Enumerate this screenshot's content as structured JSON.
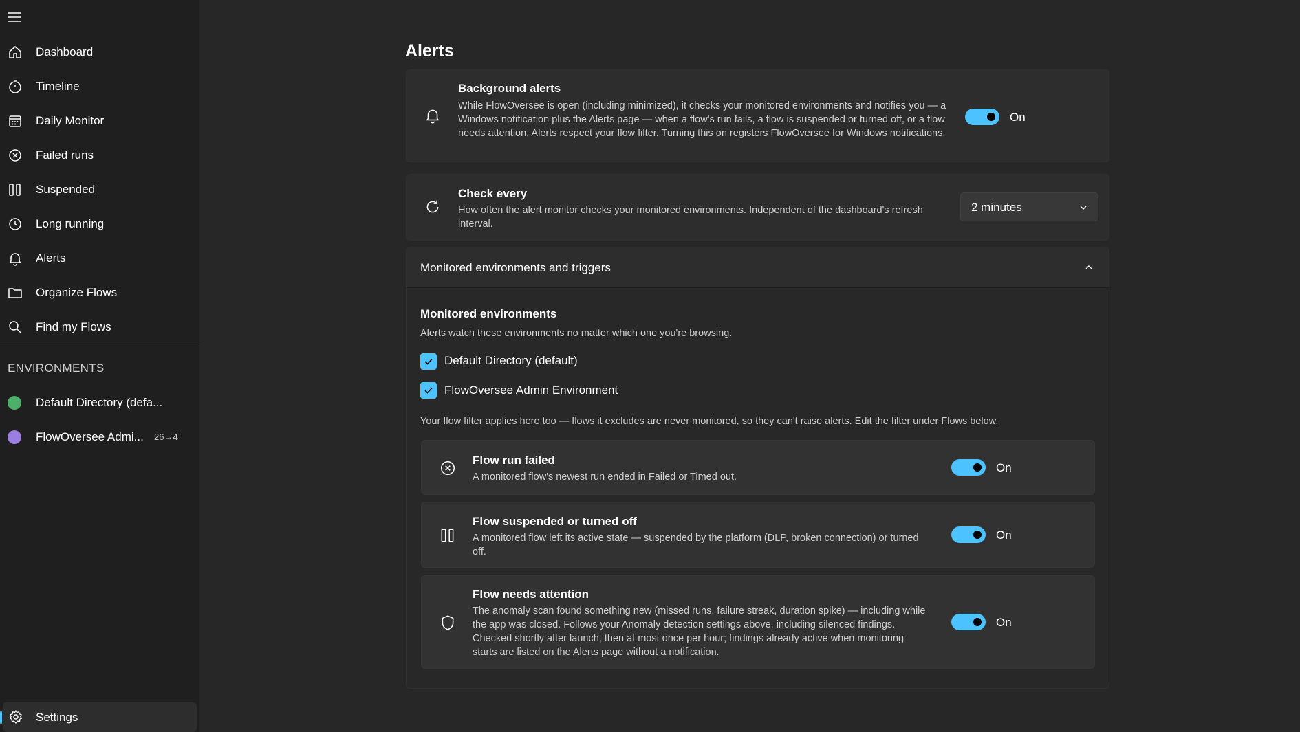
{
  "sidebar": {
    "menu_icon": "hamburger-icon",
    "items": [
      {
        "label": "Dashboard",
        "icon": "home-icon"
      },
      {
        "label": "Timeline",
        "icon": "stopwatch-icon"
      },
      {
        "label": "Daily Monitor",
        "icon": "calendar-icon"
      },
      {
        "label": "Failed runs",
        "icon": "x-circle-icon"
      },
      {
        "label": "Suspended",
        "icon": "pause-icon"
      },
      {
        "label": "Long running",
        "icon": "clock-icon"
      },
      {
        "label": "Alerts",
        "icon": "bell-icon"
      },
      {
        "label": "Organize Flows",
        "icon": "folder-icon"
      },
      {
        "label": "Find my Flows",
        "icon": "search-icon"
      }
    ],
    "environments_header": "ENVIRONMENTS",
    "environments": [
      {
        "label": "Default Directory (defa...",
        "color": "#4caf6a",
        "badge": ""
      },
      {
        "label": "FlowOversee Admi...",
        "color": "#9b7fe0",
        "badge": "26→4"
      }
    ],
    "settings": {
      "label": "Settings",
      "icon": "gear-icon"
    }
  },
  "page": {
    "title": "Alerts"
  },
  "background_alerts": {
    "title": "Background alerts",
    "description": "While FlowOversee is open (including minimized), it checks your monitored environments and notifies you — a Windows notification plus the Alerts page — when a flow's run fails, a flow is suspended or turned off, or a flow needs attention. Alerts respect your flow filter. Turning this on registers FlowOversee for Windows notifications.",
    "toggle_state": "On",
    "icon": "bell-icon"
  },
  "check_every": {
    "title": "Check every",
    "description": "How often the alert monitor checks your monitored environments. Independent of the dashboard's refresh interval.",
    "selected": "2 minutes",
    "icon": "refresh-icon"
  },
  "expander": {
    "title": "Monitored environments and triggers",
    "monitored_title": "Monitored environments",
    "monitored_desc": "Alerts watch these environments no matter which one you're browsing.",
    "environments": [
      {
        "label": "Default Directory (default)",
        "checked": true
      },
      {
        "label": "FlowOversee Admin Environment",
        "checked": true
      }
    ],
    "filter_note": "Your flow filter applies here too — flows it excludes are never monitored, so they can't raise alerts. Edit the filter under Flows below.",
    "triggers": [
      {
        "title": "Flow run failed",
        "description": "A monitored flow's newest run ended in Failed or Timed out.",
        "toggle_state": "On",
        "icon": "x-circle-icon"
      },
      {
        "title": "Flow suspended or turned off",
        "description": "A monitored flow left its active state — suspended by the platform (DLP, broken connection) or turned off.",
        "toggle_state": "On",
        "icon": "pause-icon"
      },
      {
        "title": "Flow needs attention",
        "description": "The anomaly scan found something new (missed runs, failure streak, duration spike) — including while the app was closed. Follows your Anomaly detection settings above, including silenced findings. Checked shortly after launch, then at most once per hour; findings already active when monitoring starts are listed on the Alerts page without a notification.",
        "toggle_state": "On",
        "icon": "shield-icon"
      }
    ]
  },
  "colors": {
    "accent": "#4cc2ff",
    "background": "#272727",
    "sidebar": "#1f1f1f",
    "card": "#2d2d2d"
  }
}
